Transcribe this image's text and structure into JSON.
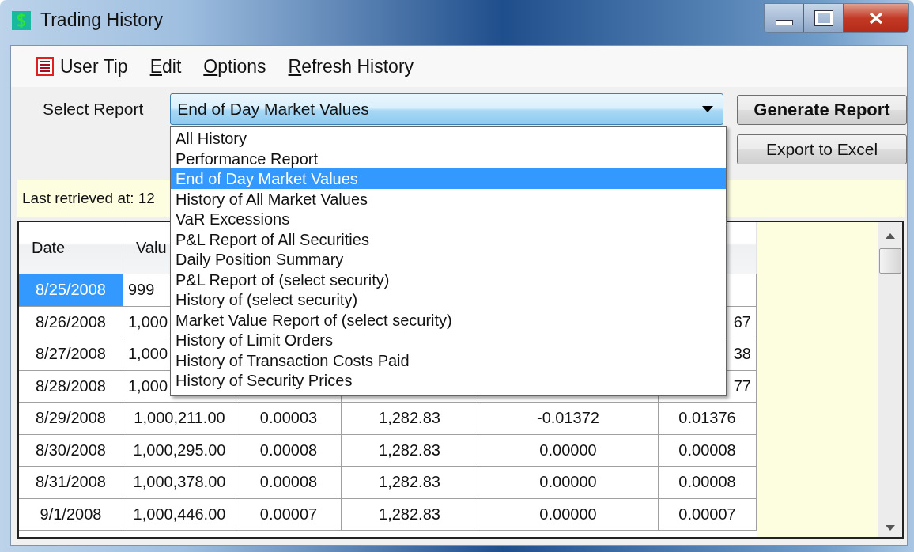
{
  "window": {
    "title": "Trading History"
  },
  "menu": [
    {
      "label": "User Tip",
      "kind": "icon",
      "underline_first": false
    },
    {
      "label": "Edit",
      "kind": "text",
      "underline_first": true
    },
    {
      "label": "Options",
      "kind": "text",
      "underline_first": true
    },
    {
      "label": "Refresh History",
      "kind": "text",
      "underline_first": true
    }
  ],
  "report": {
    "label": "Select Report",
    "value": "End of Day Market Values",
    "expanded": true,
    "options": [
      {
        "label": "All History",
        "selected": false
      },
      {
        "label": "Performance Report",
        "selected": false
      },
      {
        "label": "End of Day Market Values",
        "selected": true
      },
      {
        "label": "History of All Market Values",
        "selected": false
      },
      {
        "label": "VaR Excessions",
        "selected": false
      },
      {
        "label": "P&L Report of All Securities",
        "selected": false
      },
      {
        "label": "Daily Position Summary",
        "selected": false
      },
      {
        "label": "P&L Report of (select security)",
        "selected": false
      },
      {
        "label": "History of (select security)",
        "selected": false
      },
      {
        "label": "Market Value Report of (select security)",
        "selected": false
      },
      {
        "label": "History of Limit Orders",
        "selected": false
      },
      {
        "label": "History of Transaction Costs Paid",
        "selected": false
      },
      {
        "label": "History of Security Prices",
        "selected": false
      }
    ]
  },
  "buttons": [
    {
      "label": "Generate Report",
      "kind": "primary"
    },
    {
      "label": "Export to Excel",
      "kind": "normal"
    }
  ],
  "info": {
    "text": "Last retrieved at: 12"
  },
  "table": {
    "columns": [
      "Date",
      "Valu",
      null,
      null,
      null,
      null
    ],
    "rows": [
      {
        "selected": true,
        "clipped": true,
        "cells": [
          "8/25/2008",
          "999",
          null,
          null,
          null,
          null
        ]
      },
      {
        "selected": false,
        "clipped": true,
        "cells": [
          "8/26/2008",
          "1,000",
          null,
          null,
          null,
          "67"
        ]
      },
      {
        "selected": false,
        "clipped": true,
        "cells": [
          "8/27/2008",
          "1,000",
          null,
          null,
          null,
          "38"
        ]
      },
      {
        "selected": false,
        "clipped": true,
        "cells": [
          "8/28/2008",
          "1,000",
          null,
          null,
          null,
          "77"
        ]
      },
      {
        "selected": false,
        "clipped": false,
        "cells": [
          "8/29/2008",
          "1,000,211.00",
          "0.00003",
          "1,282.83",
          "-0.01372",
          "0.01376"
        ]
      },
      {
        "selected": false,
        "clipped": false,
        "cells": [
          "8/30/2008",
          "1,000,295.00",
          "0.00008",
          "1,282.83",
          "0.00000",
          "0.00008"
        ]
      },
      {
        "selected": false,
        "clipped": false,
        "cells": [
          "8/31/2008",
          "1,000,378.00",
          "0.00008",
          "1,282.83",
          "0.00000",
          "0.00008"
        ]
      },
      {
        "selected": false,
        "clipped": false,
        "cells": [
          "9/1/2008",
          "1,000,446.00",
          "0.00007",
          "1,282.83",
          "0.00000",
          "0.00007"
        ]
      }
    ]
  }
}
